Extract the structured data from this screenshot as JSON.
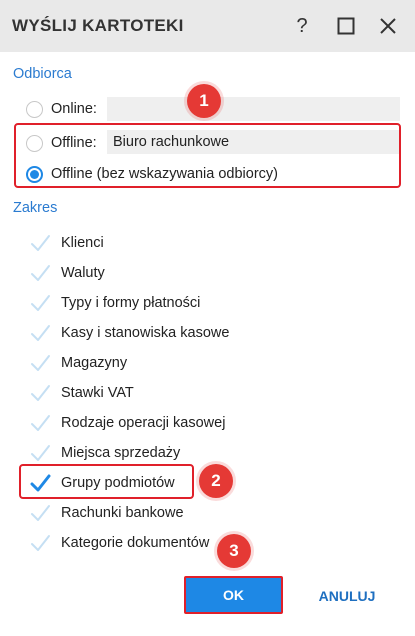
{
  "window": {
    "title": "WYŚLIJ KARTOTEKI",
    "help_label": "?"
  },
  "recipient": {
    "section_label": "Odbiorca",
    "options": [
      {
        "label": "Online:",
        "value": "",
        "selected": false
      },
      {
        "label": "Offline:",
        "value": "Biuro rachunkowe",
        "selected": false
      },
      {
        "label": "Offline (bez wskazywania odbiorcy)",
        "selected": true
      }
    ]
  },
  "scope": {
    "section_label": "Zakres",
    "items": [
      {
        "label": "Klienci",
        "checked": false
      },
      {
        "label": "Waluty",
        "checked": false
      },
      {
        "label": "Typy i formy płatności",
        "checked": false
      },
      {
        "label": "Kasy i stanowiska kasowe",
        "checked": false
      },
      {
        "label": "Magazyny",
        "checked": false
      },
      {
        "label": "Stawki VAT",
        "checked": false
      },
      {
        "label": "Rodzaje operacji kasowej",
        "checked": false
      },
      {
        "label": "Miejsca sprzedaży",
        "checked": false
      },
      {
        "label": "Grupy podmiotów",
        "checked": true
      },
      {
        "label": "Rachunki bankowe",
        "checked": false
      },
      {
        "label": "Kategorie dokumentów",
        "checked": false
      }
    ]
  },
  "annotations": {
    "badges": [
      "1",
      "2",
      "3"
    ]
  },
  "buttons": {
    "ok_label": "OK",
    "cancel_label": "ANULUJ"
  },
  "colors": {
    "accent": "#1e88e5",
    "annotation": "#e0202a",
    "check_inactive": "#c5dff3",
    "titlebar": "#e9e9e9"
  }
}
